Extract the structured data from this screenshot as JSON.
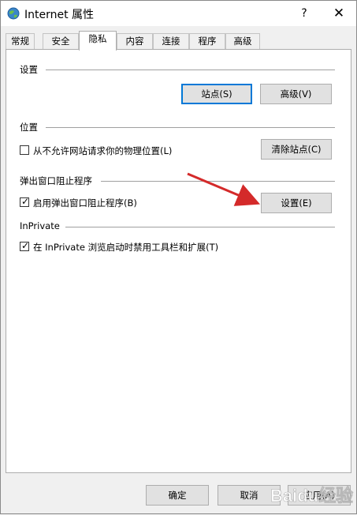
{
  "window": {
    "title": "Internet 属性",
    "help": "?",
    "close": "✕"
  },
  "tabs": [
    {
      "label": "常规"
    },
    {
      "label": "安全"
    },
    {
      "label": "隐私",
      "active": true
    },
    {
      "label": "内容"
    },
    {
      "label": "连接"
    },
    {
      "label": "程序"
    },
    {
      "label": "高级"
    }
  ],
  "settings_group": {
    "label": "设置",
    "sites_button": "站点(S)",
    "advanced_button": "高级(V)"
  },
  "location_group": {
    "label": "位置",
    "never_allow_checkbox": "从不允许网站请求你的物理位置(L)",
    "never_allow_checked": false,
    "clear_sites_button": "清除站点(C)"
  },
  "popup_group": {
    "label": "弹出窗口阻止程序",
    "enable_checkbox": "启用弹出窗口阻止程序(B)",
    "enable_checked": true,
    "settings_button": "设置(E)"
  },
  "inprivate_group": {
    "label": "InPrivate",
    "disable_toolbars_checkbox": "在 InPrivate 浏览启动时禁用工具栏和扩展(T)",
    "disable_toolbars_checked": true
  },
  "footer": {
    "ok_button": "确定",
    "cancel_button": "取消",
    "apply_button": "应用(A)"
  },
  "watermark_text": "Baidu经验",
  "colors": {
    "focus_border": "#0078d7",
    "arrow": "#d42a2a"
  }
}
